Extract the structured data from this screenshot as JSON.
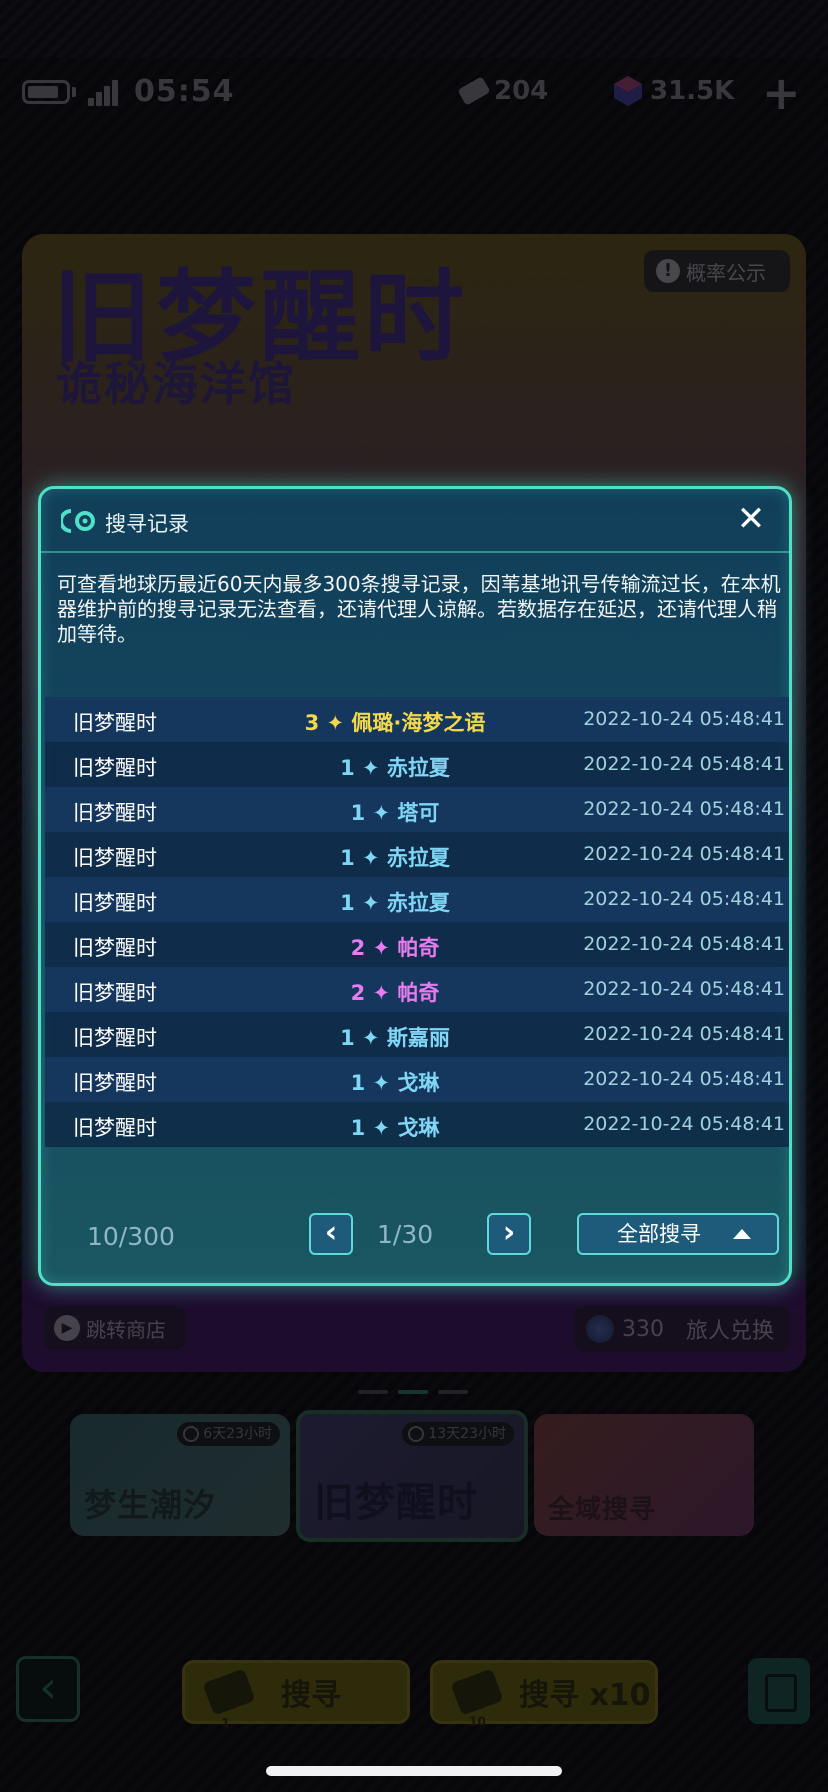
{
  "status": {
    "time": "05:54",
    "currency1": "204",
    "currency2": "31.5K",
    "plus": "+"
  },
  "banner": {
    "title": "旧梦醒时",
    "subtitle": "诡秘海洋馆",
    "probability_label": "概率公示",
    "jump_shop_label": "跳转商店",
    "exchange_count": "330",
    "exchange_label": "旅人兑换"
  },
  "cards": [
    {
      "label": "梦生潮汐",
      "timer": "6天23小时"
    },
    {
      "label": "旧梦醒时",
      "timer": "13天23小时"
    },
    {
      "label": "全域搜寻",
      "timer": ""
    }
  ],
  "bottom": {
    "search1_label": "搜寻",
    "search1_cost": "1",
    "search10_label": "搜寻 x10",
    "search10_cost": "10"
  },
  "dialog": {
    "title": "搜寻记录",
    "note": "可查看地球历最近60天内最多300条搜寻记录，因苇基地讯号传输流过长，在本机器维护前的搜寻记录无法查看，还请代理人谅解。若数据存在延迟，还请代理人稍加等待。",
    "colors": {
      "3": "#f2d84a",
      "2": "#e67cf0",
      "1": "#7fd6f5"
    },
    "records": [
      {
        "pool": "旧梦醒时",
        "rarity": 3,
        "result": "3 ✦ 佩璐·海梦之语",
        "time": "2022-10-24 05:48:41"
      },
      {
        "pool": "旧梦醒时",
        "rarity": 1,
        "result": "1 ✦ 赤拉夏",
        "time": "2022-10-24 05:48:41"
      },
      {
        "pool": "旧梦醒时",
        "rarity": 1,
        "result": "1 ✦ 塔可",
        "time": "2022-10-24 05:48:41"
      },
      {
        "pool": "旧梦醒时",
        "rarity": 1,
        "result": "1 ✦ 赤拉夏",
        "time": "2022-10-24 05:48:41"
      },
      {
        "pool": "旧梦醒时",
        "rarity": 1,
        "result": "1 ✦ 赤拉夏",
        "time": "2022-10-24 05:48:41"
      },
      {
        "pool": "旧梦醒时",
        "rarity": 2,
        "result": "2 ✦ 帕奇",
        "time": "2022-10-24 05:48:41"
      },
      {
        "pool": "旧梦醒时",
        "rarity": 2,
        "result": "2 ✦ 帕奇",
        "time": "2022-10-24 05:48:41"
      },
      {
        "pool": "旧梦醒时",
        "rarity": 1,
        "result": "1 ✦ 斯嘉丽",
        "time": "2022-10-24 05:48:41"
      },
      {
        "pool": "旧梦醒时",
        "rarity": 1,
        "result": "1 ✦ 戈琳",
        "time": "2022-10-24 05:48:41"
      },
      {
        "pool": "旧梦醒时",
        "rarity": 1,
        "result": "1 ✦ 戈琳",
        "time": "2022-10-24 05:48:41"
      }
    ],
    "count": "10/300",
    "page": "1/30",
    "filter_label": "全部搜寻"
  }
}
